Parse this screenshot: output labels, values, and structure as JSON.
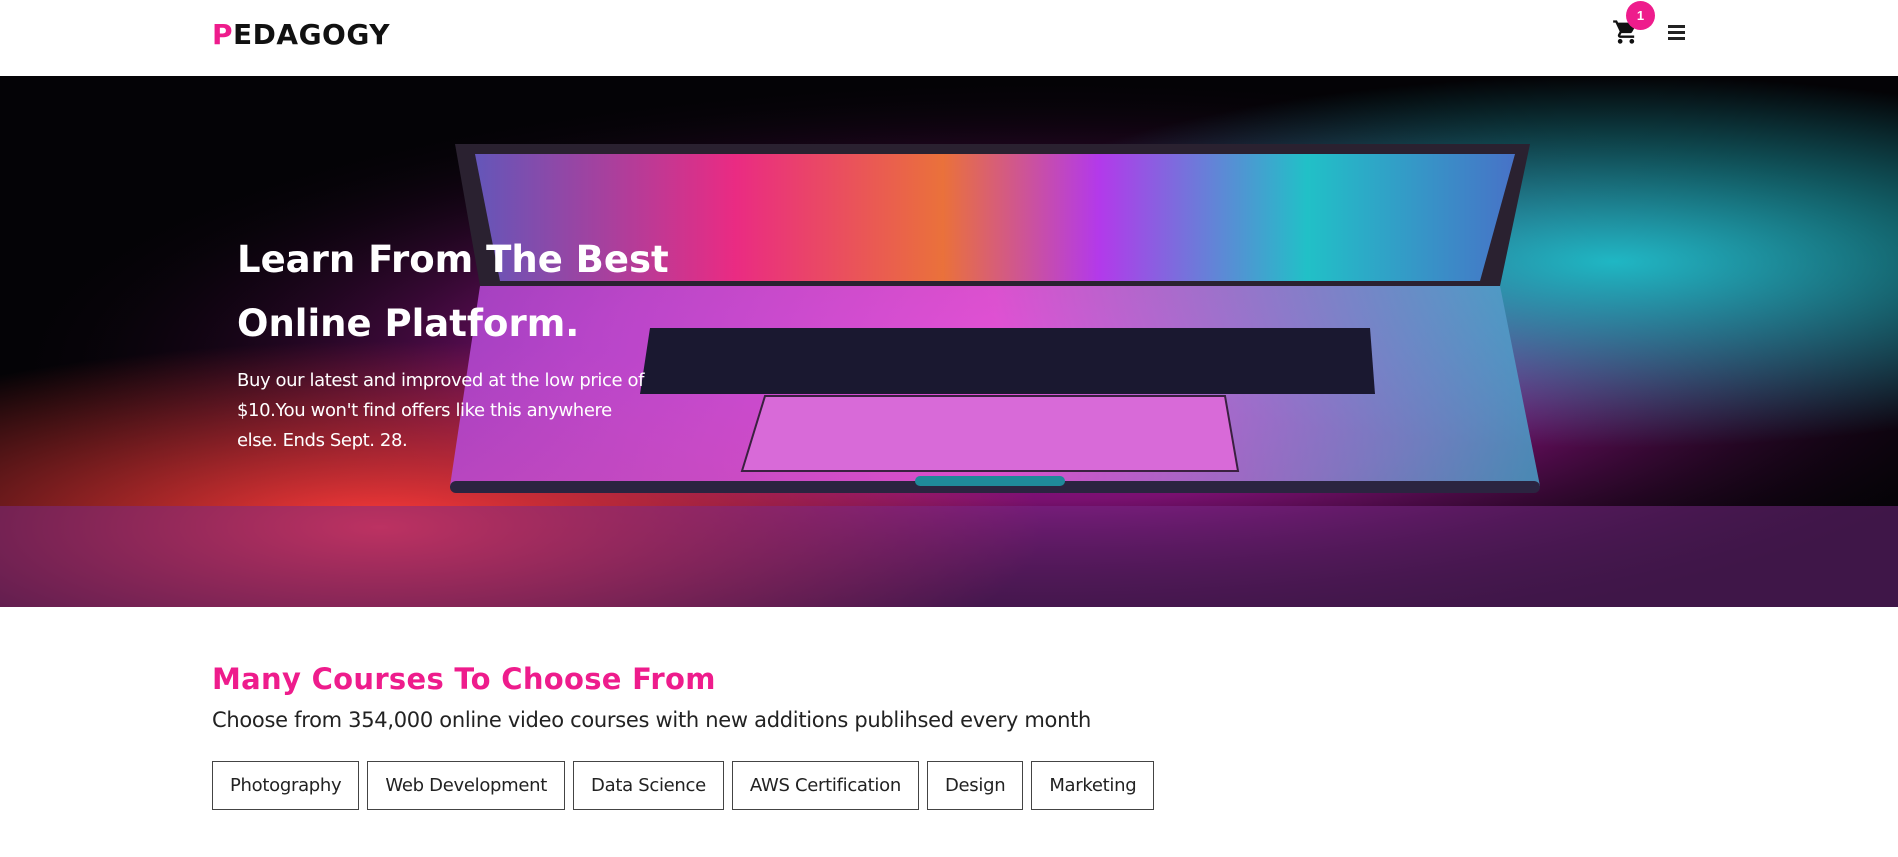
{
  "header": {
    "logo_first": "P",
    "logo_rest": "EDAGOGY",
    "cart_count": "1",
    "icons": {
      "cart": "shopping-cart-icon",
      "menu": "hamburger-menu-icon"
    }
  },
  "hero": {
    "title_line1": "Learn From The Best",
    "title_line2": "Online Platform.",
    "description": "Buy our latest and improved at the low price of $10.You won't find offers like this anywhere else. Ends Sept. 28."
  },
  "courses": {
    "title": "Many Courses To Choose From",
    "subtitle": "Choose from 354,000 online video courses with new additions publihsed every month",
    "categories": [
      "Photography",
      "Web Development",
      "Data Science",
      "AWS Certification",
      "Design",
      "Marketing"
    ]
  },
  "colors": {
    "accent": "#ee1c8c",
    "text": "#222222",
    "hero_bg": "#030205"
  }
}
